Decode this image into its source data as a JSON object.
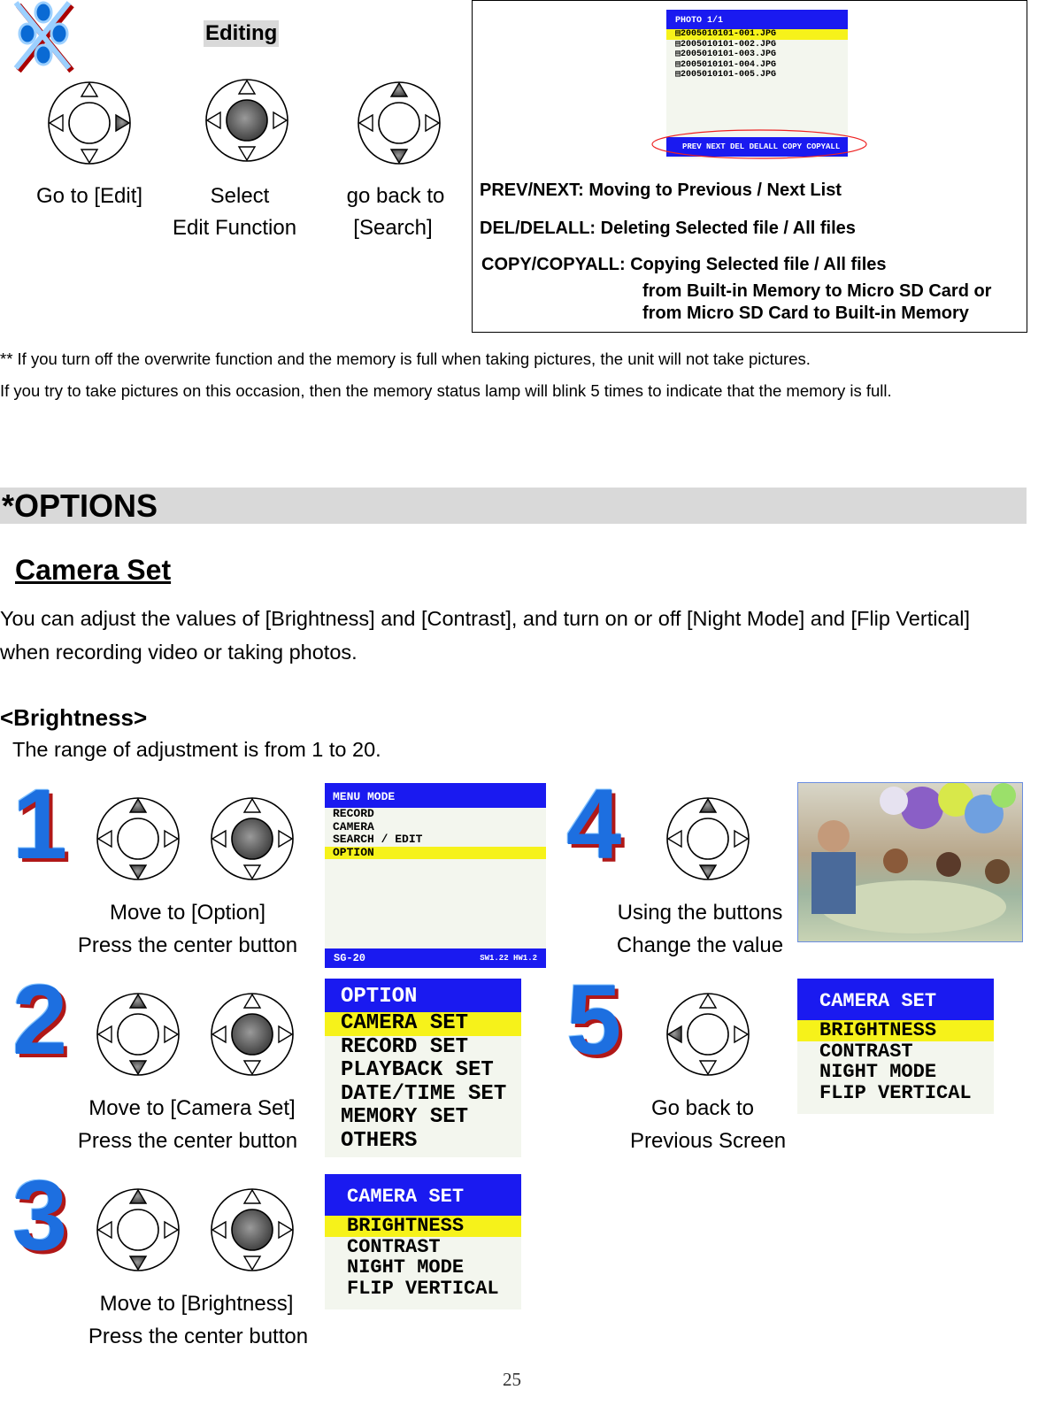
{
  "editing_section": {
    "heading": "Editing",
    "logo": "dpad-cross-logo",
    "steps": [
      {
        "lines": [
          "Go to [Edit]"
        ],
        "dpad_highlight": [
          "right"
        ]
      },
      {
        "lines": [
          "Select",
          "Edit Function"
        ],
        "dpad_highlight": [
          "center"
        ]
      },
      {
        "lines": [
          "go back to",
          "[Search]"
        ],
        "dpad_highlight": [
          "up",
          "down"
        ]
      }
    ],
    "file_screen": {
      "title": "PHOTO   1/1",
      "files": [
        "2005010101-001.JPG",
        "2005010101-002.JPG",
        "2005010101-003.JPG",
        "2005010101-004.JPG",
        "2005010101-005.JPG"
      ],
      "selected_index": 0,
      "softkeys": "PREV NEXT DEL DELALL COPY COPYALL"
    },
    "legend": [
      {
        "key": "PREV/NEXT:",
        "desc": "Moving to Previous / Next List"
      },
      {
        "key": "DEL/DELALL:",
        "desc": "Deleting Selected file / All files"
      },
      {
        "key": "COPY/COPYALL:",
        "desc": "Copying Selected file / All files",
        "extra": [
          "from Built-in Memory to Micro SD Card or",
          "from Micro SD Card to Built-in Memory"
        ]
      }
    ]
  },
  "notes": [
    "** If you turn off the overwrite function and the memory is full when taking pictures, the unit will not take pictures.",
    "If you try to take pictures on this occasion, then the memory status lamp will blink 5 times to indicate that the memory is full."
  ],
  "options": {
    "title": "*OPTIONS",
    "camera_set_title": "Camera Set",
    "intro": [
      " You can adjust the values of [Brightness] and [Contrast], and turn on or off [Night Mode] and [Flip Vertical]",
      "when recording video or taking photos."
    ],
    "brightness_heading": "<Brightness>",
    "brightness_range": "The range of adjustment is from 1 to 20.",
    "steps": [
      {
        "number": "1",
        "lines": [
          "Move to [Option]",
          "Press the center button"
        ]
      },
      {
        "number": "2",
        "lines": [
          "Move to [Camera Set]",
          "Press the center button"
        ]
      },
      {
        "number": "3",
        "lines": [
          "Move to [Brightness]",
          "Press the center button"
        ]
      },
      {
        "number": "4",
        "lines": [
          "Using the buttons",
          "Change the value"
        ]
      },
      {
        "number": "5",
        "lines": [
          "Go back to",
          "Previous Screen"
        ]
      }
    ],
    "screens": {
      "menu_mode": {
        "title": "MENU MODE",
        "items": [
          "RECORD",
          "CAMERA",
          "SEARCH / EDIT",
          "OPTION"
        ],
        "selected_index": 3,
        "footer_left": "SG-20",
        "footer_right": "SW1.22 HW1.2"
      },
      "option": {
        "title": "OPTION",
        "items": [
          "CAMERA SET",
          "RECORD SET",
          "PLAYBACK SET",
          "DATE/TIME SET",
          "MEMORY SET",
          "OTHERS"
        ],
        "selected_index": 0
      },
      "camera_set": {
        "title": "CAMERA SET",
        "items": [
          "BRIGHTNESS",
          "CONTRAST",
          "NIGHT MODE",
          "FLIP VERTICAL"
        ],
        "selected_index": 0
      }
    }
  },
  "colors": {
    "lcd_blue": "#1a1af0",
    "lcd_yellow": "#f6f21a",
    "numeral_blue": "#1d6fe0",
    "numeral_shadow": "#b01818",
    "band_gray": "#d9d9d9"
  },
  "page_number": "25"
}
